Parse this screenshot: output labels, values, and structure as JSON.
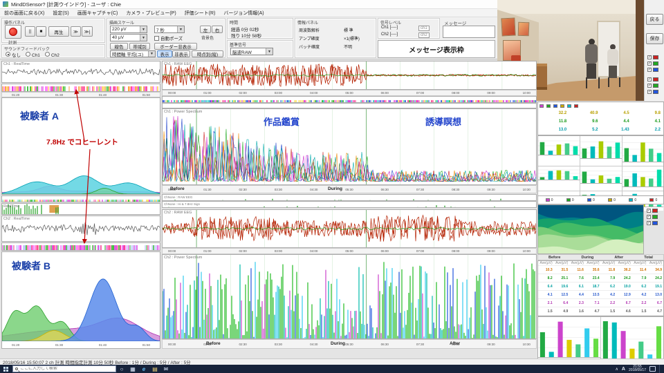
{
  "window": {
    "title": "MindDSensor?  [計測ウインドウ]   -   ユーザ : Chie"
  },
  "menu": {
    "items": [
      "前の画面に戻る(X)",
      "設定(S)",
      "画面キャプチャ(C)",
      "カメラ・プレビュー(P)",
      "評価シート(R)",
      "バージョン情報(A)"
    ]
  },
  "icons": {
    "pause": "||",
    "stop": "■",
    "ff": "≫",
    "ffend": "≫|",
    "caret": "▼",
    "check": "✓",
    "tray_up": "∧",
    "cortana": "○",
    "taskview": "▦",
    "edge": "e",
    "folder": "▤",
    "mail": "✉"
  },
  "toolbar": {
    "op_label": "操作パネル",
    "record": "計測",
    "play": "再生",
    "sound_label": "サウンドフィードバック",
    "sound_opts": [
      "なし",
      "Ch1",
      "Ch2"
    ],
    "bg_label": "背景色",
    "bg_left": "左",
    "bg_right": "右",
    "scale_label": "描画スケール",
    "scale_v1": "220 μV",
    "scale_v2": "40 μV",
    "line_color": "線色",
    "band": "帯域別",
    "h_scale": "7 秒",
    "autopause": "自動ポーズ",
    "border_hide": "ボーダー非表示",
    "time_avg": "時間軸 平均(ユ)",
    "show": "表示",
    "hide": "非表示",
    "timepoint": "時点別(縦)",
    "time_label": "時間",
    "time_row1": "経過   0分 02秒",
    "time_row2": "残り  10分 58秒",
    "ref_label": "基準信号",
    "ref_value": "脳波RAW",
    "info_label": "情報パネル",
    "info_rows": [
      [
        "周波数解析",
        "標 準"
      ],
      [
        "アンプ確度",
        "×1(標準)"
      ],
      [
        "バッチ確度",
        "不明"
      ]
    ],
    "sig_label": "信号レベル",
    "sig_ch1": "Ch1 [----]",
    "sig_ch2": "Ch2 [----]",
    "sig_f1": "ch1",
    "sig_f2": "ch2",
    "msg_label": "メッセージ",
    "msg_frame": "メッセージ表示枠"
  },
  "side_buttons": {
    "back": "戻る",
    "save": "保存"
  },
  "annotations": {
    "subject_a": "被験者 A",
    "subject_b": "被験者 B",
    "coherent": "7.8Hz でコヒーレント",
    "art": "作品鑑賞",
    "meditation": "誘導瞑想"
  },
  "panels": {
    "l_ch1_label": "Ch1 : RealTime",
    "l_rt_label": "RealTime",
    "l_ch2_label": "Ch2 : RealTime",
    "c1_label": "Ch1 : RAW EEG",
    "c5_label": "Ch1 : Power Spectrum",
    "c7_label": "ChNone : RAW EEG",
    "c8_label": "ChNone : Hi & 7.8Hz Sign",
    "c9_label": "Ch2 : RAW EEG",
    "c11_label": "Ch2 : Power Spectrum"
  },
  "axes": {
    "before": "Before",
    "during": "During",
    "after": "After",
    "left_ticks": [
      "01:20",
      "01:30",
      "01:40",
      "01:50"
    ],
    "top_ticks": [
      "00:00",
      "01:00",
      "02:00",
      "03:00",
      "04:00",
      "05:00",
      "06:00",
      "07:00",
      "08:00",
      "09:00",
      "10:00"
    ],
    "center_ticks": [
      "00:30",
      "01:30",
      "02:30",
      "03:30",
      "04:30",
      "05:30",
      "06:30",
      "07:30",
      "08:30",
      "09:30",
      "10:30"
    ]
  },
  "right": {
    "chip_colors": [
      "#cc44cc",
      "#22aa22",
      "#2255dd",
      "#ccaa00",
      "#00bbcc",
      "#cc2222"
    ],
    "legend_colors": [
      "#cc2222",
      "#22aa22",
      "#2255dd"
    ],
    "mini_table": {
      "rows": [
        {
          "c": "#b8a000",
          "v": [
            "32.2",
            "40.9",
            "4.5",
            "9.8"
          ]
        },
        {
          "c": "#1a9a1a",
          "v": [
            "11.8",
            "9.6",
            "4.4",
            "4.1"
          ]
        },
        {
          "c": "#0099aa",
          "v": [
            "13.0",
            "5.2",
            "1.43",
            "2.2"
          ]
        }
      ]
    },
    "zeros": [
      "0",
      "0",
      "0",
      "0",
      "0",
      "0"
    ],
    "table_groups": [
      "Before",
      "During",
      "After",
      "Total"
    ],
    "table_subheader": "Ave(μV)",
    "table_rows": [
      {
        "c": "#d07000",
        "v": [
          "10.3",
          "31.5",
          "11.6",
          "35.6",
          "11.8",
          "36.2",
          "11.4",
          "34.9"
        ]
      },
      {
        "c": "#1a9a1a",
        "v": [
          "8.2",
          "25.1",
          "7.6",
          "23.4",
          "7.9",
          "24.2",
          "7.9",
          "24.2"
        ]
      },
      {
        "c": "#00a0a0",
        "v": [
          "6.4",
          "19.6",
          "6.1",
          "18.7",
          "6.2",
          "19.0",
          "6.2",
          "19.1"
        ]
      },
      {
        "c": "#2255cc",
        "v": [
          "4.1",
          "12.5",
          "4.4",
          "13.5",
          "4.2",
          "12.9",
          "4.2",
          "13.0"
        ]
      },
      {
        "c": "#b030b0",
        "v": [
          "2.1",
          "6.4",
          "2.3",
          "7.1",
          "2.2",
          "6.7",
          "2.2",
          "6.7"
        ]
      },
      {
        "c": "#555555",
        "v": [
          "1.5",
          "4.9",
          "1.6",
          "4.7",
          "1.5",
          "4.6",
          "1.5",
          "4.7"
        ]
      }
    ]
  },
  "statusbar": {
    "text": "2018/05/16 15:50:07      2 ch 計測     時間指定計測   10分 50秒     Before : 1分   /   During : 5分   /   After : 5分"
  },
  "taskbar": {
    "search_placeholder": "ここに入力して検索",
    "ime": "A",
    "time": "21:55",
    "date": "2018/05/17"
  },
  "charts": {
    "l1": {
      "kind": "wave",
      "seed": 11,
      "color": "#555555",
      "segs": [
        {
          "u": 1,
          "a": 0.28
        }
      ]
    },
    "l2": {
      "kind": "spectro",
      "seed": 21,
      "palette": [
        "#e040e0",
        "#ff80ff",
        "#40c040",
        "#ffa040",
        "#ffffff",
        "#ff4090",
        "#ffd050"
      ]
    },
    "la": {
      "kind": "area",
      "series": [
        {
          "color": "#cc44cc",
          "fill": "rgba(220,120,220,0.55)",
          "peaks": [
            {
              "c": 0.5,
              "w": 0.5,
              "h": 0.1
            },
            {
              "c": 0.3,
              "w": 0.06,
              "h": 0.18
            }
          ]
        },
        {
          "color": "#00a0b4",
          "fill": "rgba(90,210,225,0.85)",
          "peaks": [
            {
              "c": 0.22,
              "w": 0.1,
              "h": 0.42
            },
            {
              "c": 0.52,
              "w": 0.09,
              "h": 0.62
            },
            {
              "c": 0.8,
              "w": 0.09,
              "h": 0.38
            }
          ]
        },
        {
          "color": "#2aa02a",
          "fill": "rgba(120,210,120,0.45)",
          "peaks": [
            {
              "c": 0.65,
              "w": 0.05,
              "h": 0.2
            }
          ]
        }
      ]
    },
    "l4": {
      "kind": "spectro",
      "seed": 22,
      "palette": [
        "#40c040",
        "#ffe060",
        "#ff80c0",
        "#80e0e0",
        "#ffffff",
        "#e040e0"
      ]
    },
    "l5": {
      "kind": "ticks",
      "seed": 31,
      "color": "#20a020",
      "clusters": [
        {
          "u": 0.25,
          "d": 0.85
        },
        {
          "u": 1,
          "d": 0.05
        }
      ],
      "blocks": [
        {
          "x": 0.3,
          "w": 0.06,
          "color": "#e0a050"
        }
      ]
    },
    "l6": {
      "kind": "wave",
      "seed": 12,
      "color": "#555555",
      "segs": [
        {
          "u": 0.5,
          "a": 0.3
        },
        {
          "u": 0.6,
          "a": 0.55
        },
        {
          "u": 1,
          "a": 0.25
        }
      ]
    },
    "l7": {
      "kind": "spectro",
      "seed": 23,
      "palette": [
        "#e040e0",
        "#ff80ff",
        "#ffffff",
        "#40c040",
        "#ff4090",
        "#c0c0ff"
      ]
    },
    "lb": {
      "kind": "area",
      "series": [
        {
          "color": "#b030b0",
          "fill": "rgba(190,90,200,0.6)",
          "peaks": [
            {
              "c": 0.45,
              "w": 0.35,
              "h": 0.18
            },
            {
              "c": 0.75,
              "w": 0.12,
              "h": 0.22
            }
          ]
        },
        {
          "color": "#2aa02a",
          "fill": "rgba(110,205,110,0.8)",
          "peaks": [
            {
              "c": 0.08,
              "w": 0.05,
              "h": 0.42
            },
            {
              "c": 0.22,
              "w": 0.06,
              "h": 0.52
            },
            {
              "c": 0.38,
              "w": 0.05,
              "h": 0.28
            }
          ]
        },
        {
          "color": "#c8b400",
          "fill": "rgba(235,215,80,0.7)",
          "peaks": [
            {
              "c": 0.33,
              "w": 0.07,
              "h": 0.16
            }
          ]
        },
        {
          "color": "#2060d0",
          "fill": "rgba(90,140,235,0.85)",
          "peaks": [
            {
              "c": 0.64,
              "w": 0.085,
              "h": 0.93
            },
            {
              "c": 0.86,
              "w": 0.05,
              "h": 0.2
            }
          ]
        }
      ]
    },
    "c1": {
      "kind": "wave",
      "seed": 41,
      "color": "#b42000",
      "passes": 2,
      "overlay": "#009900",
      "vgrid": true,
      "segs": [
        {
          "u": 0.545,
          "a": 0.82
        },
        {
          "u": 1,
          "a": 0.06
        }
      ]
    },
    "c3": {
      "kind": "spectro",
      "seed": 24,
      "palette": [
        "#e040e0",
        "#40c040",
        "#4060e0",
        "#ffe060",
        "#ffffff",
        "#ff4090",
        "#40d0d0"
      ]
    },
    "c4": {
      "kind": "spectro",
      "seed": 25,
      "palette": [
        "#ffffff",
        "#ffd0f0",
        "#d0ffd0",
        "#f0f0a0",
        "#d0e0ff",
        "#ffb0d0"
      ]
    },
    "c5": {
      "kind": "spikes",
      "vgrid": true,
      "series": [
        {
          "color": "#cc2222",
          "seed": 51
        },
        {
          "color": "#22aa22",
          "seed": 52
        },
        {
          "color": "#2244cc",
          "seed": 53
        },
        {
          "color": "#cc22cc",
          "seed": 54
        },
        {
          "color": "#ee8800",
          "seed": 55
        },
        {
          "color": "#00aaaa",
          "seed": 56
        }
      ]
    },
    "c7": {
      "kind": "ticks",
      "seed": 32,
      "color": "#20a020",
      "clusters": [
        {
          "u": 1,
          "d": 0.18
        }
      ]
    },
    "c8": {
      "kind": "ticks",
      "seed": 33,
      "color": "#20a020",
      "clusters": [
        {
          "u": 1,
          "d": 0.12
        }
      ]
    },
    "c9": {
      "kind": "wave",
      "seed": 42,
      "color": "#b42000",
      "passes": 2,
      "overlay": "#009900",
      "vgrid": true,
      "segs": [
        {
          "u": 0.08,
          "a": 0.3
        },
        {
          "u": 0.3,
          "a": 0.65
        },
        {
          "u": 0.55,
          "a": 0.45
        },
        {
          "u": 0.8,
          "a": 0.72
        },
        {
          "u": 1,
          "a": 0.4
        }
      ]
    },
    "c11": {
      "kind": "vlines",
      "seed": 61,
      "vgrid": true,
      "colors": [
        [
          "#22bb22",
          0.5
        ],
        [
          "#00bbaa",
          0.15
        ],
        [
          "#33ccee",
          0.13
        ],
        [
          "#2255dd",
          0.12
        ],
        [
          "#cc44cc",
          0.1
        ]
      ]
    },
    "contour": {
      "kind": "contour",
      "seed": 81,
      "palette": [
        "#00557f",
        "#007f86",
        "#16a06a",
        "#44bb66",
        "#77cc77",
        "#aadd99",
        "#d5f0c0"
      ]
    },
    "bar_grid": {
      "kind": "bargrid",
      "seedBase": 71,
      "rows": 3,
      "cols": 3,
      "n": 5,
      "colors": [
        "#22aa44",
        "#00bbbb",
        "#aacc00",
        "#44cc88",
        "#00ddaa"
      ]
    },
    "bar_bottom": {
      "kind": "bargrid",
      "seedBase": 91,
      "rows": 1,
      "cols": 2,
      "n": 7,
      "colors": [
        "#22aa44",
        "#00bbbb",
        "#cc44cc",
        "#ddcc00",
        "#44cc88",
        "#33ccee",
        "#66dd44"
      ]
    }
  }
}
